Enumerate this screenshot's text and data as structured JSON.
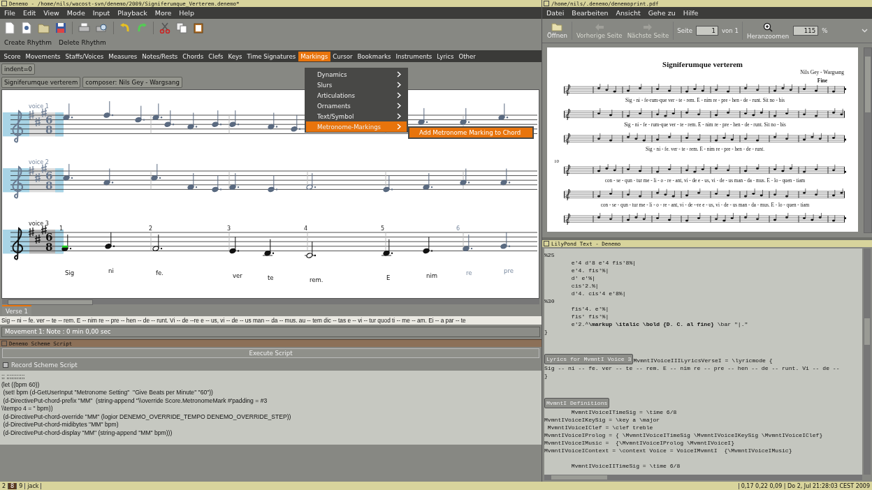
{
  "editor": {
    "title": "Denemo - /home/nils/wacost-svn/denemo/2009/Signiferumque_Verterem.denemo*",
    "menu": [
      "File",
      "Edit",
      "View",
      "Mode",
      "Input",
      "Playback",
      "More",
      "Help"
    ],
    "rhythm_buttons": [
      "Create Rhythm",
      "Delete Rhythm"
    ],
    "command_menu": [
      {
        "label": "Score",
        "selected": false
      },
      {
        "label": "Movements",
        "selected": false
      },
      {
        "label": "Staffs/Voices",
        "selected": false
      },
      {
        "label": "Measures",
        "selected": false
      },
      {
        "label": "Notes/Rests",
        "selected": false
      },
      {
        "label": "Chords",
        "selected": false
      },
      {
        "label": "Clefs",
        "selected": false
      },
      {
        "label": "Keys",
        "selected": false
      },
      {
        "label": "Time Signatures",
        "selected": false
      },
      {
        "label": "Markings",
        "selected": true
      },
      {
        "label": "Cursor",
        "selected": false
      },
      {
        "label": "Bookmarks",
        "selected": false
      },
      {
        "label": "Instruments",
        "selected": false
      },
      {
        "label": "Lyrics",
        "selected": false
      },
      {
        "label": "Other",
        "selected": false
      }
    ],
    "markings_menu": [
      {
        "label": "Dynamics",
        "selected": false
      },
      {
        "label": "Slurs",
        "selected": false
      },
      {
        "label": "Articulations",
        "selected": false
      },
      {
        "label": "Ornaments",
        "selected": false
      },
      {
        "label": "Text/Symbol",
        "selected": false
      },
      {
        "label": "Metronome-Markings",
        "selected": true
      }
    ],
    "submenu": [
      {
        "label": "Add Metronome Marking to Chord",
        "selected": true
      }
    ],
    "indent_button": "indent=0",
    "header_buttons": [
      "Signiferumque verterem",
      "composer: Nils Gey - Wargsang"
    ],
    "staves": [
      {
        "voice": "voice 1",
        "time_signature": [
          "6",
          "8"
        ],
        "current": false
      },
      {
        "voice": "voice 2",
        "time_signature": [
          "6",
          "8"
        ],
        "current": false
      },
      {
        "voice": "voice 3",
        "time_signature": [
          "6",
          "8"
        ],
        "current": true
      }
    ],
    "measure_numbers": [
      "1",
      "2",
      "3",
      "4",
      "5",
      "6"
    ],
    "lyrics": [
      "Sig",
      "ni",
      "fe.",
      "ver",
      "te",
      "rem.",
      "E",
      "nim",
      "re",
      "pre"
    ],
    "verse_tabs": [
      {
        "label": "Verse 1",
        "selected": true
      }
    ],
    "lyrics_text": "Sig -- ni -- fe. ver -- te -- rem. E -- nim re -- pre -- hen -- de -- runt. Vi -- de --re e -- us, vi -- de -- us man -- da -- mus.  au -- tem dic -- tas e -- vi -- tur quod ti -- me -- am. Ei -- a par -- te",
    "status": "Movement 1: Note : 0 min 0,00 sec"
  },
  "script_panel": {
    "title": "Denemo Scheme Script",
    "execute_button": "Execute Script",
    "record": {
      "label": "Record Scheme Script",
      "checked": false
    },
    "code": [
      ";; ;;;;;;;;;;;",
      "(let ((bpm 60))",
      " (set! bpm (d-GetUserInput \"Metronome Setting\"  \"Give Beats per Minute\" \"60\"))",
      " (d-DirectivePut-chord-prefix \"MM\"  (string-append \"\\\\override Score.MetronomeMark #'padding = #3",
      "\\\\tempo 4 = \" bpm))",
      " (d-DirectivePut-chord-override \"MM\" (logior DENEMO_OVERRIDE_TEMPO DENEMO_OVERRIDE_STEP))",
      " (d-DirectivePut-chord-midibytes \"MM\" bpm)",
      " (d-DirectivePut-chord-display \"MM\" (string-append \"MM\" bpm)))"
    ]
  },
  "pdf_viewer": {
    "title": "/home/nils/.denemo/denemoprint.pdf",
    "menu": [
      "Datei",
      "Bearbeiten",
      "Ansicht",
      "Gehe zu",
      "Hilfe"
    ],
    "open_button": "Öffnen",
    "nav_buttons": [
      {
        "label": "Vorherige Seite",
        "disabled": true,
        "kind": "back"
      },
      {
        "label": "Nächste Seite",
        "disabled": true,
        "kind": "forward"
      }
    ],
    "page_label": "Seite",
    "page": "1",
    "page_total": "von 1",
    "zoom_in_button": "Heranzoomen",
    "zoom": "115",
    "zoom_unit": "%",
    "document": {
      "title": "Signiferumque verterem",
      "composer": "Nils Gey - Wargsang",
      "fine": "Fine",
      "systems": [
        {
          "lyrics": [
            "Sig - ni - fe-rum-que ver - te - rem. E - nim re - pre - hen - de - runt. Sit no - bis",
            "Sig - ni - fe - rum-que ver - te - rem. E - nim re - pre - hen - de - runt. Sit no - bis",
            "Sig - ni - fe. ver - te - rem. E - nim re - pre - hen - de - runt."
          ]
        },
        {
          "measure_number": "10",
          "lyrics": [
            "con - se - qun - tur me - li - o - re - ant, vi - de e - us, vi - de - us man - da - mus. E - lo - quen - tiam",
            "con - se - qun - tur me - li - o - re - ant, vi - de --re e - us, vi - de - us man - da - mus. E - lo - quen - tiam"
          ]
        }
      ]
    }
  },
  "lilypond": {
    "title": "LilyPond Text - Denemo",
    "lines": [
      {
        "kind": "code",
        "text": "%25"
      },
      {
        "kind": "code",
        "text": "        e'4 d'8 e'4 fis'8%|"
      },
      {
        "kind": "code",
        "text": "        e'4. fis'%|"
      },
      {
        "kind": "code",
        "text": "        d' e'%|"
      },
      {
        "kind": "code",
        "text": "        cis'2.%|"
      },
      {
        "kind": "code",
        "text": "        d'4. cis'4 e'8%|"
      },
      {
        "kind": "code",
        "text": "%30"
      },
      {
        "kind": "code",
        "text": "        fis'4. e'%|"
      },
      {
        "kind": "code",
        "text": "        fis' fis'%|"
      },
      {
        "kind": "code",
        "text": "        e'2.^**\\markup \\italic \\bold {D. C. al fine}** \\bar \"|.\""
      },
      {
        "kind": "code",
        "text": "}"
      },
      {
        "kind": "anchor",
        "label": "Lyrics for MvmntI Voice 3",
        "text": "MvmntIVoiceIIILyricsVerseI = \\lyricmode {"
      },
      {
        "kind": "code",
        "text": "Sig -- ni -- fe. ver -- te -- rem. E -- nim re -- pre -- hen -- de -- runt. Vi -- de --"
      },
      {
        "kind": "code",
        "text": "}"
      },
      {
        "kind": "anchor",
        "label": "MvmntI Definitions"
      },
      {
        "kind": "code",
        "text": "        MvmntIVoiceITimeSig = \\time 6/8"
      },
      {
        "kind": "code",
        "text": "MvmntIVoiceIKeySig = \\key a \\major"
      },
      {
        "kind": "code",
        "text": " MvmntIVoiceIClef = \\clef treble"
      },
      {
        "kind": "code",
        "text": "MvmntIVoiceIProlog = { \\MvmntIVoiceITimeSig \\MvmntIVoiceIKeySig \\MvmntIVoiceIClef}"
      },
      {
        "kind": "code",
        "text": "MvmntIVoiceIMusic =  {\\MvmntIVoiceIProlog \\MvmntIVoiceI}"
      },
      {
        "kind": "code",
        "text": "MvmntIVoiceIContext = \\context Voice = VoiceIMvmntI  {\\MvmntIVoiceIMusic}"
      },
      {
        "kind": "gap"
      },
      {
        "kind": "code",
        "text": "        MvmntIVoiceIITimeSig = \\time 6/8"
      }
    ]
  },
  "taskbar": {
    "workspaces": [
      {
        "label": "2",
        "selected": false
      },
      {
        "label": "8",
        "selected": true
      },
      {
        "label": "9",
        "selected": false
      },
      {
        "label": "jack",
        "selected": false
      }
    ],
    "clock": "0,17 0,22 0,09 | Do 2, Jul 21:28:03 CEST 2009"
  }
}
